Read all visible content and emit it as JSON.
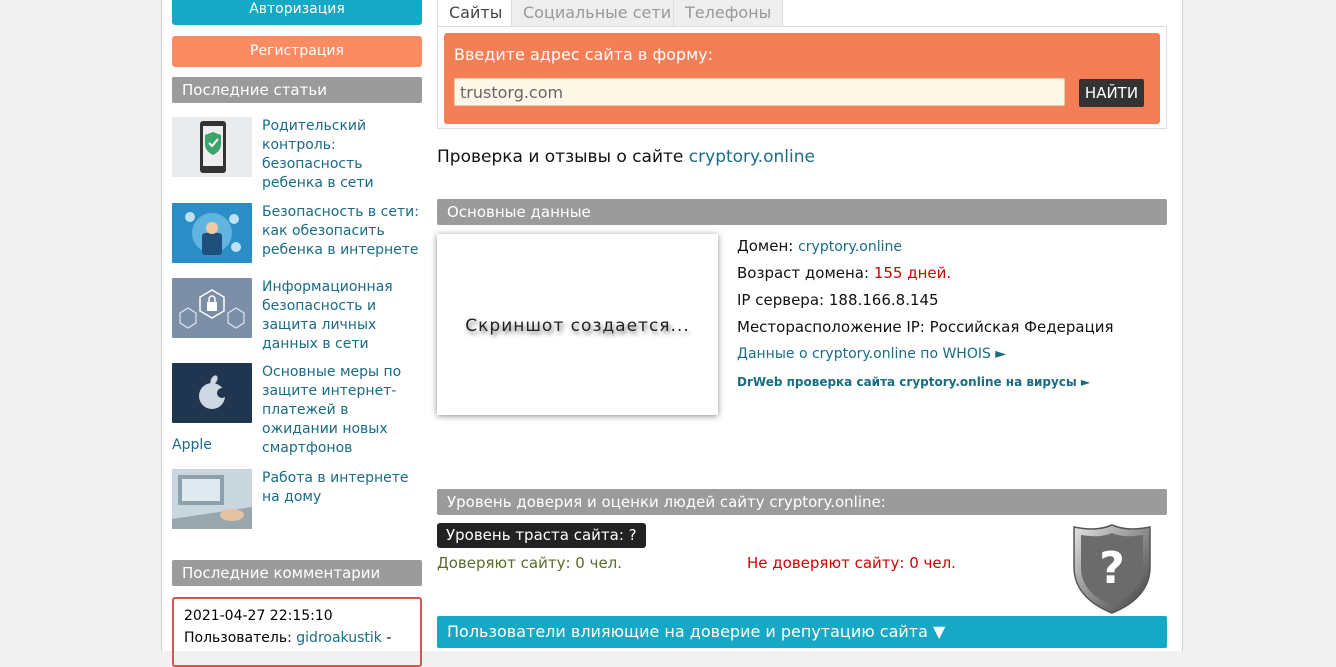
{
  "sidebar": {
    "auth_label": "Авторизация",
    "register_label": "Регистрация",
    "articles_heading": "Последние статьи",
    "articles": [
      {
        "title": "Родительский контроль: безопасность ребенка в сети",
        "tail": ""
      },
      {
        "title": "Безопасность в сети: как обезопасить ребенка в интернете",
        "tail": ""
      },
      {
        "title": "Информационная безопасность и защита личных данных в сети",
        "tail": ""
      },
      {
        "title": "Основные меры по защите интернет-платежей в ожидании новых смартфонов",
        "tail": "Apple"
      },
      {
        "title": "Работа в интернете на дому",
        "tail": ""
      }
    ],
    "comments_heading": "Последние комментарии",
    "comment": {
      "date": "2021-04-27 22:15:10",
      "user_label": "Пользователь:",
      "user": "gidroakustik",
      "dash": "-"
    }
  },
  "tabs": [
    {
      "label": "Сайты",
      "active": true
    },
    {
      "label": "Социальные сети",
      "active": false
    },
    {
      "label": "Телефоны",
      "active": false
    }
  ],
  "search": {
    "label": "Введите адрес сайта в форму:",
    "value": "trustorg.com",
    "button": "НАЙТИ"
  },
  "main": {
    "title_prefix": "Проверка и отзывы о сайте",
    "site": "cryptory.online",
    "basic_heading": "Основные данные",
    "screenshot_text": "Скриншот создается...",
    "domain_label": "Домен:",
    "domain_value": "cryptory.online",
    "age_label": "Возраст домена:",
    "age_value": "155 дней.",
    "ip_label": "IP сервера:",
    "ip_value": "188.166.8.145",
    "location_label": "Месторасположение IP:",
    "location_value": "Российская Федерация",
    "whois_link": "Данные о cryptory.online по WHOIS ►",
    "drweb_link": "DrWeb проверка сайта cryptory.online на вирусы ►",
    "trust_heading": "Уровень доверия и оценки людей сайту cryptory.online:",
    "trust_badge": "Уровень траста сайта: ?",
    "trust_yes": "Доверяют сайту: 0 чел.",
    "trust_no": "Не доверяют сайту: 0 чел.",
    "users_bar": "Пользователи влияющие на доверие и репутацию сайта ▼"
  },
  "colors": {
    "accent_blue": "#17a8c5",
    "accent_orange": "#f47e55",
    "link": "#1a6b86",
    "red": "#d40000"
  }
}
